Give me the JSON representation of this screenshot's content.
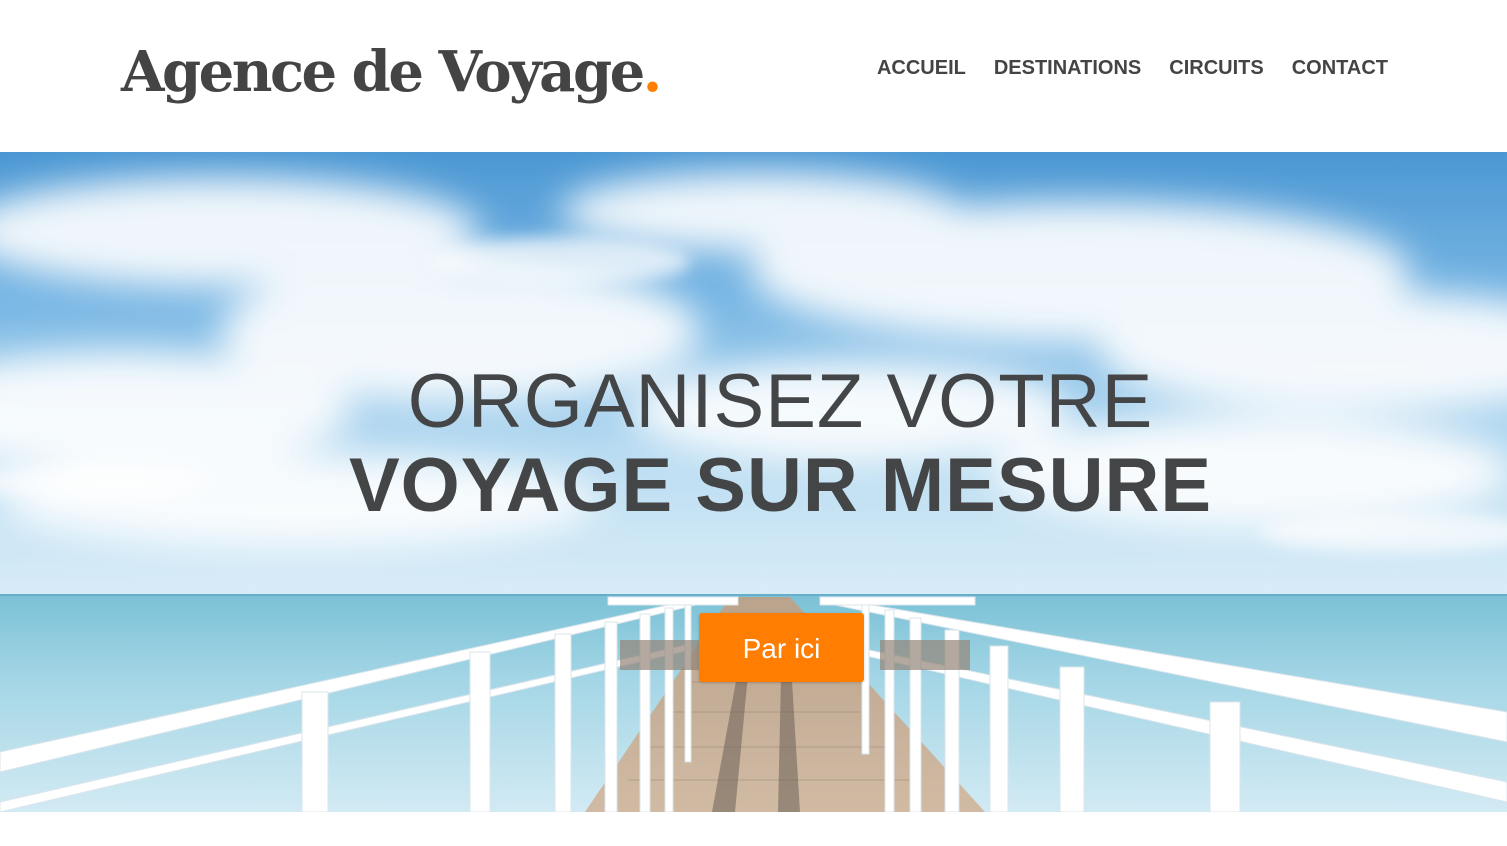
{
  "header": {
    "logo_text": "Agence de Voyage",
    "logo_dot": ".",
    "nav": [
      {
        "label": "ACCUEIL"
      },
      {
        "label": "DESTINATIONS"
      },
      {
        "label": "CIRCUITS"
      },
      {
        "label": "CONTACT"
      }
    ]
  },
  "hero": {
    "headline_line1": "ORGANISEZ VOTRE",
    "headline_line2": "VOYAGE SUR MESURE",
    "cta_label": "Par ici",
    "background_image": "pier-over-ocean-with-blue-sky"
  },
  "colors": {
    "accent": "#ff7d00",
    "text": "#444444",
    "background": "#ffffff"
  }
}
